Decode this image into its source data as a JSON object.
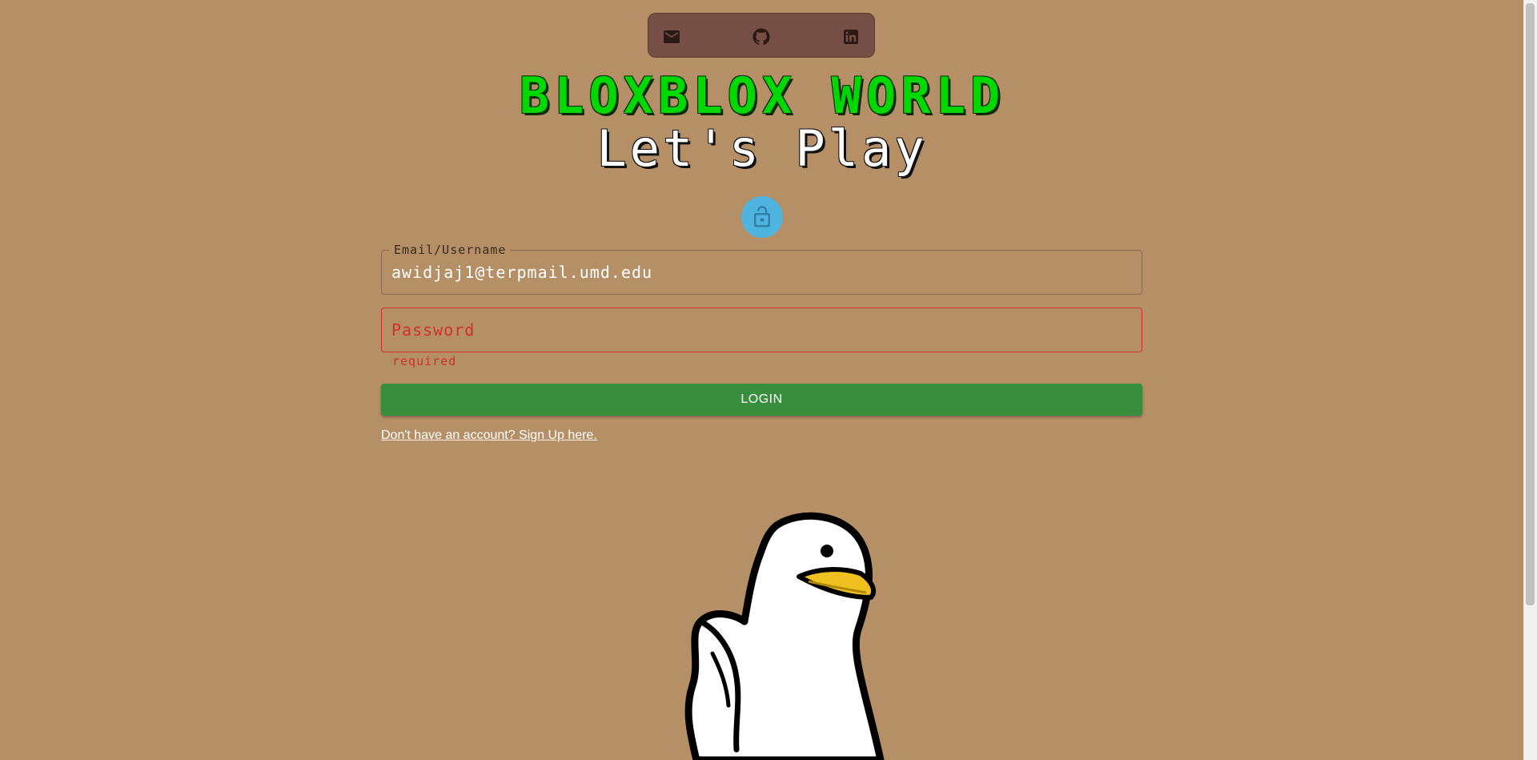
{
  "social": {
    "email_icon": "mail-icon",
    "github_icon": "github-icon",
    "linkedin_icon": "linkedin-icon"
  },
  "header": {
    "title": "BLOXBLOX WORLD",
    "subtitle": "Let's Play"
  },
  "form": {
    "email_label": "Email/Username",
    "email_value": "awidjaj1@terpmail.umd.edu",
    "password_placeholder": "Password",
    "password_helper": "required",
    "login_label": "LOGIN",
    "signup_link": "Don't have an account? Sign Up here."
  },
  "colors": {
    "background": "#b58f65",
    "title": "#00d800",
    "accent_button": "#388e3c",
    "error": "#d32f2f",
    "avatar": "#4fb4e0"
  }
}
